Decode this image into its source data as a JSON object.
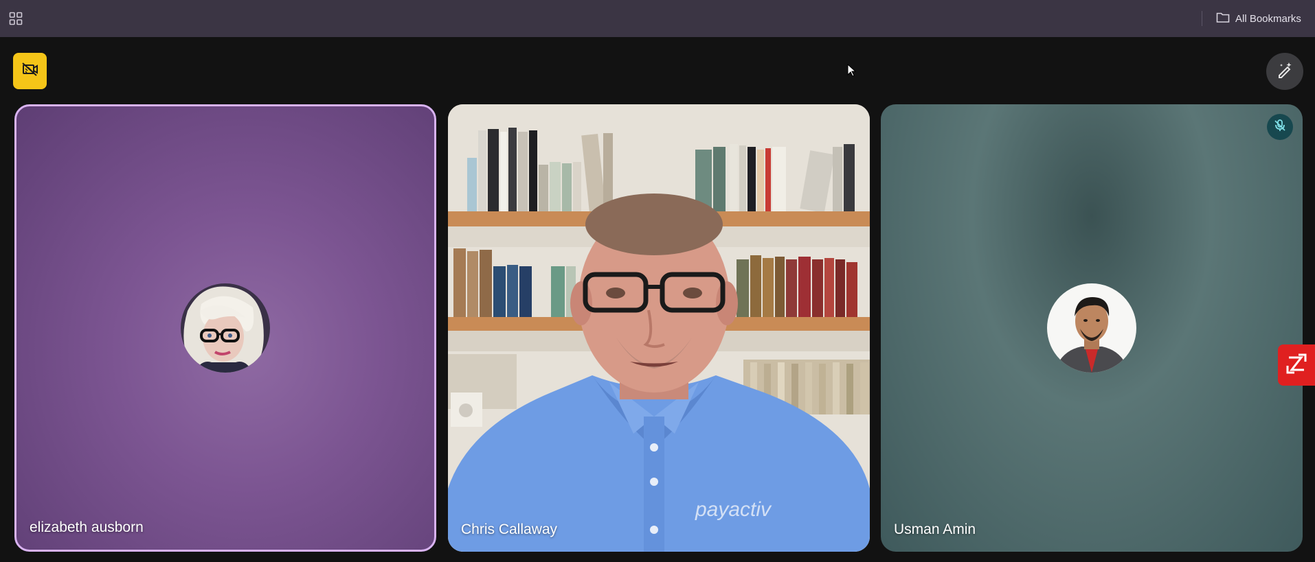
{
  "topbar": {
    "apps_icon": "grid-icon",
    "bookmarks_label": "All Bookmarks",
    "bookmarks_icon": "folder-icon"
  },
  "controls": {
    "camera_off_icon": "camera-off-icon",
    "effects_icon": "magic-pen-icon"
  },
  "participants": [
    {
      "name": "elizabeth ausborn",
      "video": "off",
      "active_speaker": true
    },
    {
      "name": "Chris Callaway",
      "video": "on",
      "shirt_text": "payactiv"
    },
    {
      "name": "Usman Amin",
      "video": "off",
      "muted": true
    }
  ],
  "colors": {
    "topbar": "#3b3544",
    "camera_button": "#f5c518",
    "speaker_border": "#d9b3f2",
    "side_widget": "#e02020"
  }
}
